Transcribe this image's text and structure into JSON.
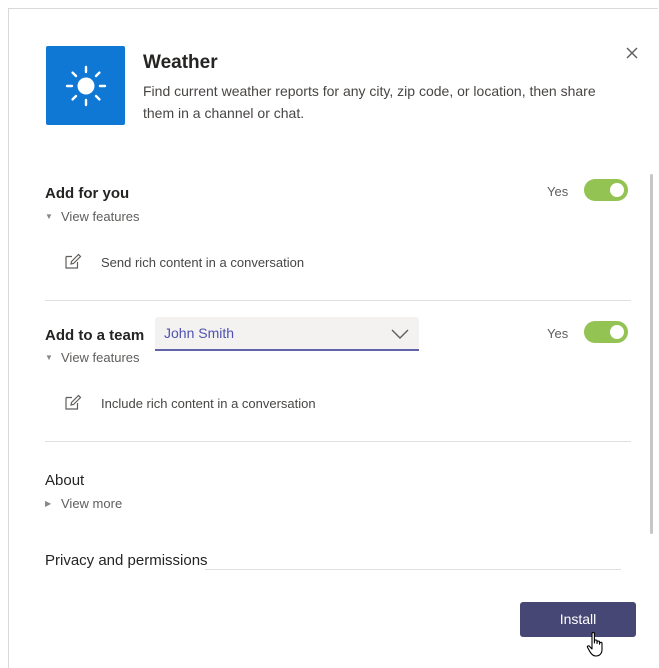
{
  "app": {
    "name": "Weather",
    "description": "Find current weather reports for any city, zip code, or location, then share them in a channel or chat.",
    "icon": "sun-icon",
    "brand_color": "#0f78d4"
  },
  "add_for_you": {
    "title": "Add for you",
    "toggle_label": "Yes",
    "toggle_on": true,
    "expander_label": "View features",
    "feature": "Send rich content in a conversation"
  },
  "add_to_team": {
    "title": "Add to a team",
    "team_selected": "John Smith",
    "toggle_label": "Yes",
    "toggle_on": true,
    "expander_label": "View features",
    "feature": "Include rich content in a conversation"
  },
  "about": {
    "title": "About",
    "expander_label": "View more"
  },
  "privacy": {
    "title": "Privacy and permissions"
  },
  "footer": {
    "install_label": "Install",
    "button_color": "#464775"
  },
  "colors": {
    "toggle_on": "#92c353",
    "select_accent": "#6264a7"
  }
}
